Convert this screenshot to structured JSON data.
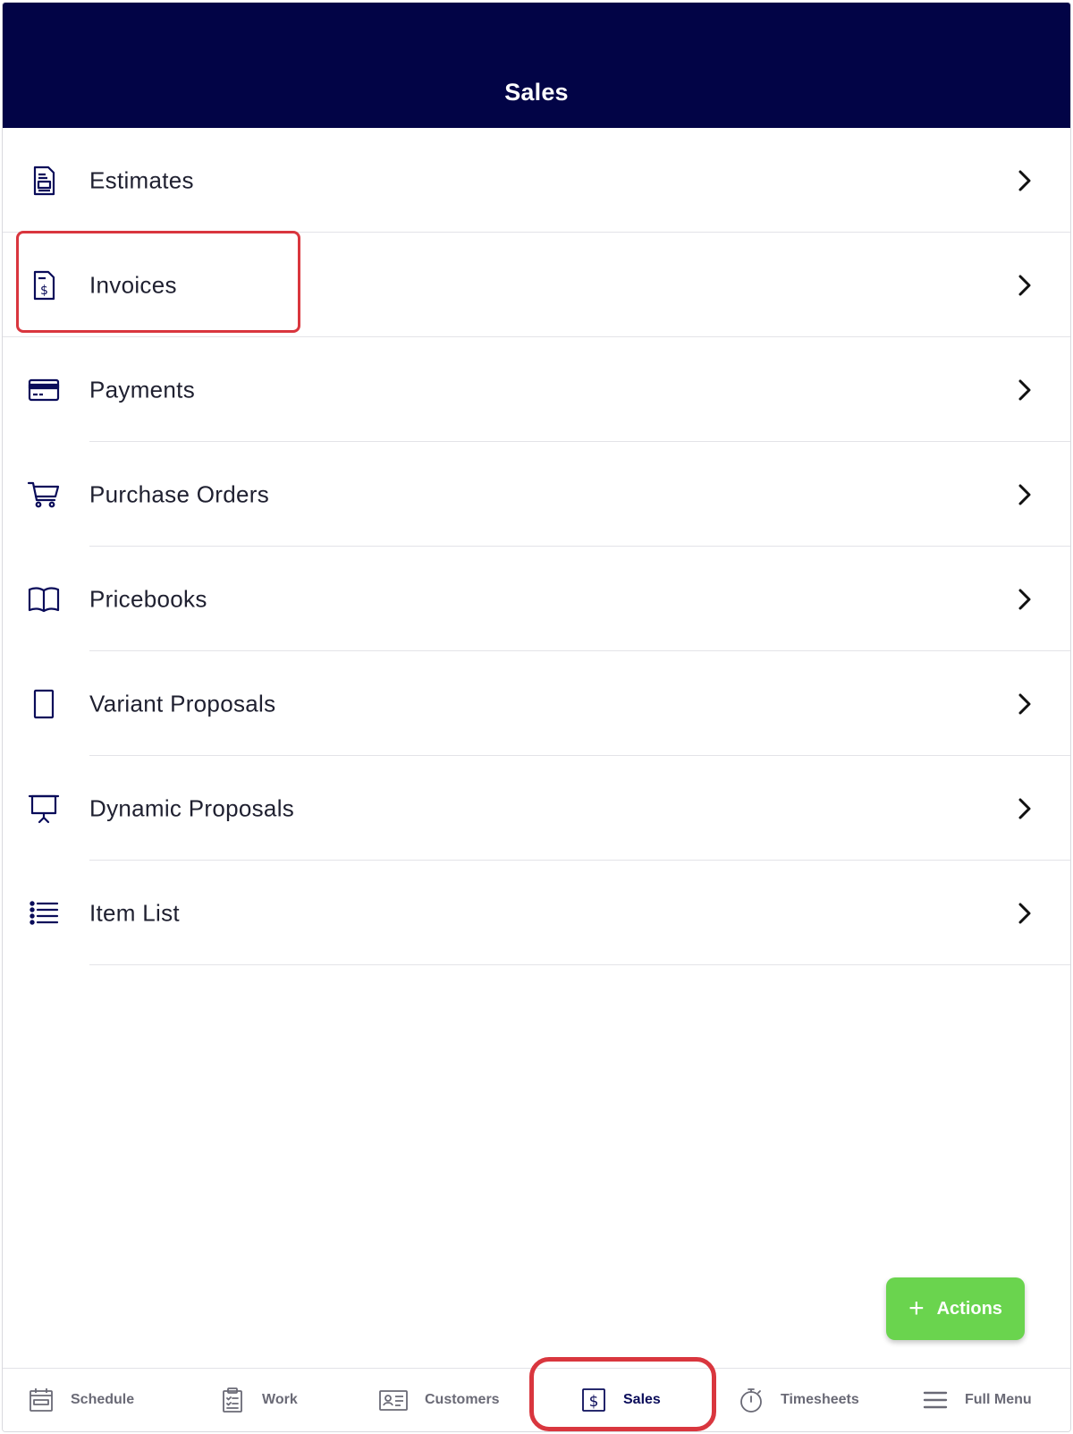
{
  "header": {
    "title": "Sales"
  },
  "menu": {
    "items": [
      {
        "label": "Estimates",
        "icon": "estimate-document-icon"
      },
      {
        "label": "Invoices",
        "icon": "invoice-dollar-icon"
      },
      {
        "label": "Payments",
        "icon": "credit-card-icon"
      },
      {
        "label": "Purchase Orders",
        "icon": "shopping-cart-icon"
      },
      {
        "label": "Pricebooks",
        "icon": "open-book-icon"
      },
      {
        "label": "Variant Proposals",
        "icon": "tablet-icon"
      },
      {
        "label": "Dynamic Proposals",
        "icon": "presentation-icon"
      },
      {
        "label": "Item List",
        "icon": "list-icon"
      }
    ],
    "chevron_icon": "chevron-right-icon"
  },
  "fab": {
    "label": "Actions",
    "icon": "plus-icon",
    "color": "#6ad44e"
  },
  "tabbar": {
    "active": "Sales",
    "tabs": [
      {
        "label": "Schedule",
        "icon": "calendar-icon"
      },
      {
        "label": "Work",
        "icon": "clipboard-icon"
      },
      {
        "label": "Customers",
        "icon": "contact-card-icon"
      },
      {
        "label": "Sales",
        "icon": "dollar-icon"
      },
      {
        "label": "Timesheets",
        "icon": "stopwatch-icon"
      },
      {
        "label": "Full Menu",
        "icon": "hamburger-menu-icon"
      }
    ]
  },
  "colors": {
    "header_bg": "#020446",
    "icon_color": "#0a0c5a",
    "annotation_red": "#d9363e",
    "divider": "#e3e3e8"
  }
}
